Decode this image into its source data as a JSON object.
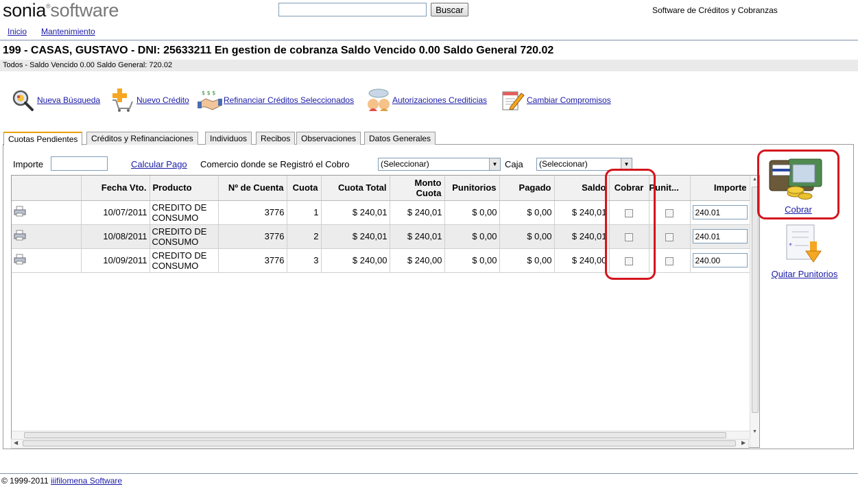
{
  "header": {
    "logo_part1": "sonia",
    "logo_reg": "®",
    "logo_part2": "software",
    "search_value": "",
    "search_button": "Buscar",
    "tagline": "Software de Créditos y Cobranzas"
  },
  "nav": {
    "inicio": "Inicio",
    "mantenimiento": "Mantenimiento"
  },
  "client": {
    "title": "199 - CASAS, GUSTAVO - DNI: 25633211   En gestion de cobranza Saldo Vencido 0.00 Saldo General 720.02",
    "subtitle": "Todos - Saldo Vencido 0.00 Saldo General: 720.02"
  },
  "actions": {
    "nueva_busqueda": "Nueva Búsqueda",
    "nuevo_credito": "Nuevo Crédito",
    "refinanciar": "Refinanciar Créditos Seleccionados",
    "autorizaciones": "Autorizaciones Crediticias",
    "cambiar": "Cambiar Compromisos"
  },
  "tabs": [
    "Cuotas Pendientes",
    "Créditos y Refinanciaciones",
    "Individuos",
    "Recibos",
    "Observaciones",
    "Datos Generales"
  ],
  "filter": {
    "importe_label": "Importe",
    "importe_value": "",
    "calcular_link": "Calcular Pago",
    "comercio_label": "Comercio donde se Registró el Cobro",
    "comercio_value": "(Seleccionar)",
    "caja_label": "Caja",
    "caja_value": "(Seleccionar)"
  },
  "grid": {
    "columns": {
      "fecha": "Fecha Vto.",
      "producto": "Producto",
      "cuenta": "Nº de Cuenta",
      "cuota": "Cuota",
      "cuota_total": "Cuota Total",
      "monto_cuota_1": "Monto",
      "monto_cuota_2": "Cuota",
      "punitorios": "Punitorios",
      "pagado": "Pagado",
      "saldo": "Saldo",
      "cobrar": "Cobrar",
      "punit": "Punit...",
      "importe": "Importe"
    },
    "rows": [
      {
        "fecha": "10/07/2011",
        "producto_1": "CREDITO DE",
        "producto_2": "CONSUMO",
        "cuenta": "3776",
        "cuota": "1",
        "cuota_total": "$ 240,01",
        "monto_cuota": "$ 240,01",
        "punitorios": "$ 0,00",
        "pagado": "$ 0,00",
        "saldo": "$ 240,01",
        "importe": "240.01"
      },
      {
        "fecha": "10/08/2011",
        "producto_1": "CREDITO DE",
        "producto_2": "CONSUMO",
        "cuenta": "3776",
        "cuota": "2",
        "cuota_total": "$ 240,01",
        "monto_cuota": "$ 240,01",
        "punitorios": "$ 0,00",
        "pagado": "$ 0,00",
        "saldo": "$ 240,01",
        "importe": "240.01"
      },
      {
        "fecha": "10/09/2011",
        "producto_1": "CREDITO DE",
        "producto_2": "CONSUMO",
        "cuenta": "3776",
        "cuota": "3",
        "cuota_total": "$ 240,00",
        "monto_cuota": "$ 240,00",
        "punitorios": "$ 0,00",
        "pagado": "$ 0,00",
        "saldo": "$ 240,00",
        "importe": "240.00"
      }
    ]
  },
  "side": {
    "cobrar": "Cobrar",
    "quitar": "Quitar Punitorios"
  },
  "footer": {
    "copyright": "© 1999-2011",
    "company": "iiifilomena Software"
  },
  "colors": {
    "highlight": "#d4141c",
    "link": "#1a1aa6",
    "tab_accent": "#e8a000"
  }
}
